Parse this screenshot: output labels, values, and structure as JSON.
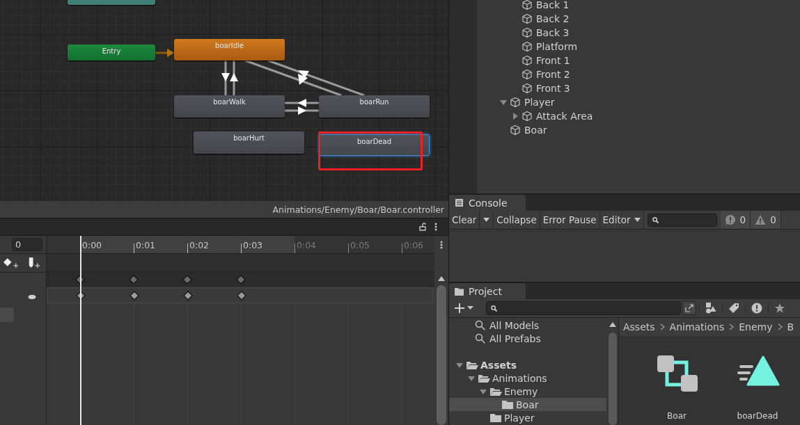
{
  "animator": {
    "nodes": [
      {
        "kind": "any",
        "selected": false
      },
      {
        "kind": "entry",
        "label": "Entry",
        "selected": false
      },
      {
        "kind": "default",
        "label": "boarIdle",
        "selected": false
      },
      {
        "kind": "state",
        "label": "boarWalk",
        "selected": false
      },
      {
        "kind": "state",
        "label": "boarRun",
        "selected": false
      },
      {
        "kind": "state",
        "label": "boarHurt",
        "selected": false
      },
      {
        "kind": "state",
        "label": "boarDead",
        "selected": true
      }
    ],
    "path": "Animations/Enemy/Boar/Boar.controller"
  },
  "animation": {
    "time": "0",
    "ticks": [
      {
        "label": "0:00",
        "in_clip": true,
        "keyframe": true
      },
      {
        "label": "0:01",
        "in_clip": true,
        "keyframe": true
      },
      {
        "label": "0:02",
        "in_clip": true,
        "keyframe": true
      },
      {
        "label": "0:03",
        "in_clip": true,
        "keyframe": true
      },
      {
        "label": "0:04",
        "in_clip": false,
        "keyframe": false
      },
      {
        "label": "0:05",
        "in_clip": false,
        "keyframe": false
      },
      {
        "label": "0:06",
        "in_clip": false,
        "keyframe": false
      }
    ],
    "tracks": [
      {
        "kind": "summary"
      },
      {
        "kind": "property"
      }
    ]
  },
  "hierarchy": {
    "items": [
      {
        "children": [
          {
            "label": "Back 1"
          },
          {
            "label": "Back 2"
          },
          {
            "label": "Back 3"
          },
          {
            "label": "Platform"
          },
          {
            "label": "Front 1"
          },
          {
            "label": "Front 2"
          },
          {
            "label": "Front 3"
          }
        ]
      },
      {
        "label": "Player",
        "expanded": true,
        "children": [
          {
            "label": "Attack Area",
            "expanded": false
          }
        ]
      },
      {
        "label": "Boar"
      }
    ]
  },
  "console": {
    "tab": "Console",
    "buttons": [
      {
        "label": "Clear",
        "kind": "split"
      },
      {
        "label": "Collapse",
        "kind": "plain"
      },
      {
        "label": "Error Pause",
        "kind": "plain"
      },
      {
        "label": "Editor",
        "kind": "dropdown"
      }
    ],
    "counts": [
      {
        "kind": "error",
        "count": "0"
      },
      {
        "kind": "warning",
        "count": "0"
      }
    ]
  },
  "project": {
    "tab": "Project",
    "favorites": [
      "All Models",
      "All Prefabs"
    ],
    "tree": [
      {
        "label": "Assets",
        "expanded": true,
        "selected": false,
        "children": [
          {
            "label": "Animations",
            "expanded": true,
            "selected": false,
            "children": [
              {
                "label": "Enemy",
                "expanded": true,
                "selected": false,
                "children": [
                  {
                    "label": "Boar",
                    "selected": true
                  }
                ]
              },
              {
                "label": "Player",
                "selected": false
              }
            ]
          }
        ]
      }
    ],
    "breadcrumb": [
      "Assets",
      "Animations",
      "Enemy",
      "B"
    ],
    "assets": [
      {
        "kind": "controller",
        "label": "Boar"
      },
      {
        "kind": "clip",
        "label": "boarDead"
      }
    ]
  }
}
